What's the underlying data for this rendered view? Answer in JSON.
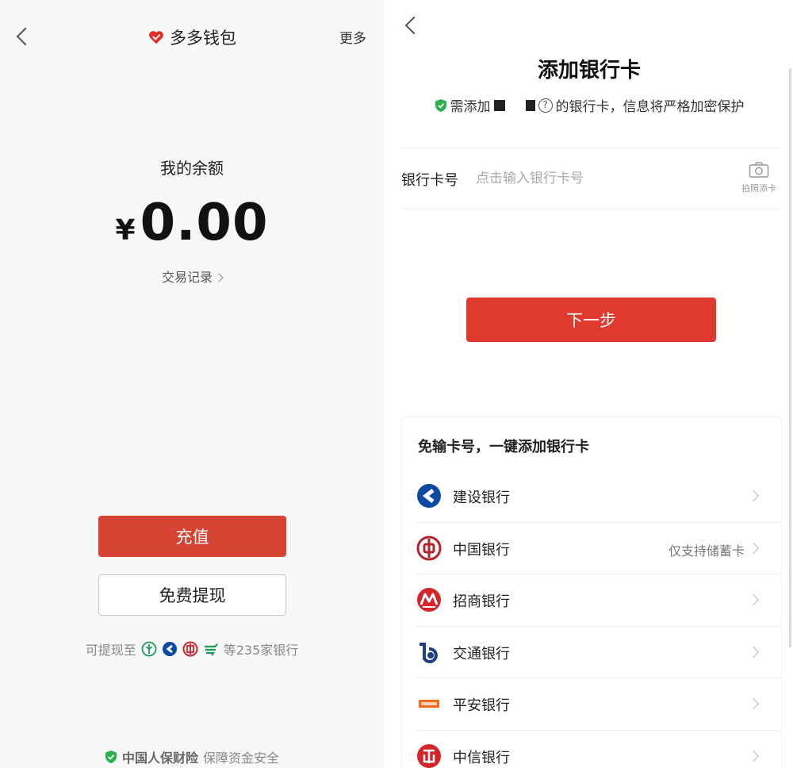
{
  "wallet": {
    "title": "多多钱包",
    "more_label": "更多",
    "balance_label": "我的余额",
    "currency_symbol": "¥",
    "balance_amount": "0.00",
    "transactions_link": "交易记录",
    "recharge_label": "充值",
    "withdraw_label": "免费提现",
    "withdraw_banks_prefix": "可提现至",
    "withdraw_banks_suffix": "等235家银行",
    "insurance_brand": "中国人保财险",
    "insurance_text": "保障资金安全",
    "icons": [
      "back-icon",
      "heart-logo-icon",
      "abc-bank-icon",
      "ccb-bank-icon",
      "icbc-bank-icon",
      "psbc-bank-icon",
      "shield-icon"
    ]
  },
  "add_card": {
    "title": "添加银行卡",
    "subtitle_prefix": "需添加",
    "subtitle_suffix": "的银行卡，信息将严格加密保护",
    "card_number_label": "银行卡号",
    "card_number_placeholder": "点击输入银行卡号",
    "card_number_value": "",
    "camera_label": "拍照添卡",
    "next_label": "下一步",
    "quick_add_title": "免输卡号，一键添加银行卡",
    "banks": [
      {
        "name": "建设银行",
        "note": "",
        "icon": "ccb-logo-icon"
      },
      {
        "name": "中国银行",
        "note": "仅支持储蓄卡",
        "icon": "boc-logo-icon"
      },
      {
        "name": "招商银行",
        "note": "",
        "icon": "cmb-logo-icon"
      },
      {
        "name": "交通银行",
        "note": "",
        "icon": "bocom-logo-icon"
      },
      {
        "name": "平安银行",
        "note": "",
        "icon": "pingan-logo-icon"
      },
      {
        "name": "中信银行",
        "note": "",
        "icon": "citic-logo-icon"
      }
    ]
  },
  "colors": {
    "primary_red": "#e03a2e",
    "recharge_red": "#d64333",
    "wallet_heart": "#e02e24",
    "shield_green": "#2bb24c",
    "ccb_blue": "#0b4aa2",
    "boc_red": "#b5232a",
    "cmb_red": "#d4262a",
    "bocom_blue": "#1d3f86",
    "pingan_orange": "#f26b1d"
  }
}
